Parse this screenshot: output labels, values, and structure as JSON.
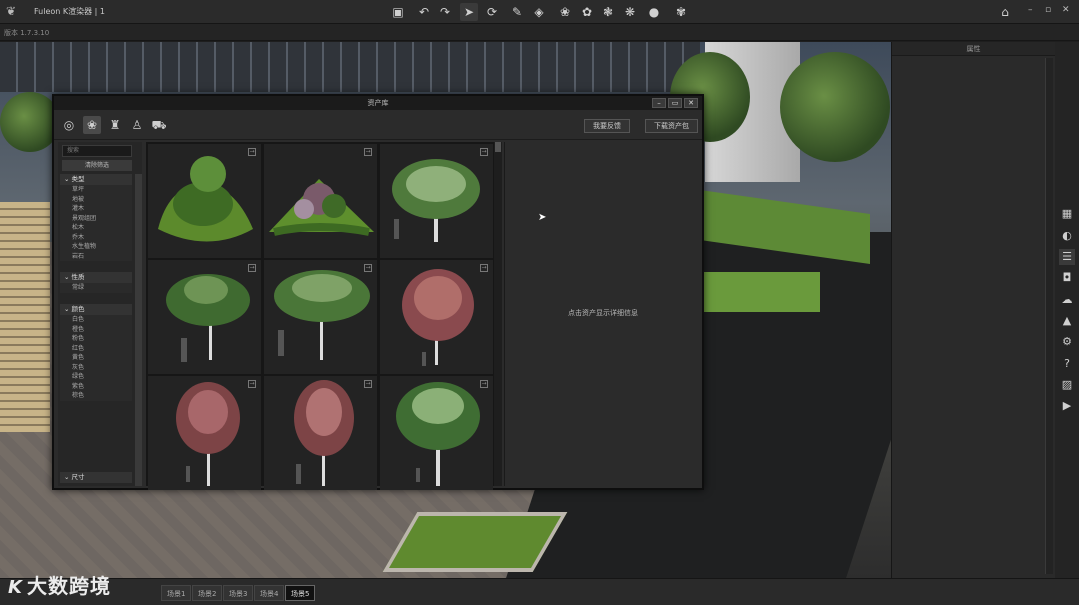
{
  "app": {
    "title": "Fuleon K渲染器 | 1",
    "version": "版本 1.7.3.10"
  },
  "toolbar": {
    "icons": [
      "save-icon",
      "undo-icon",
      "redo-icon",
      "select-icon",
      "rotate-icon",
      "pen-icon",
      "paint-bucket-icon",
      "tree-brush-icon",
      "tree-scatter-icon",
      "grass-icon",
      "plant-icon",
      "shrub-icon",
      "leaf-icon",
      "home-icon"
    ]
  },
  "props_panel": {
    "title": "属性"
  },
  "dialog": {
    "title": "资产库",
    "feedback_button": "我要反馈",
    "download_button": "下载资产包",
    "search_placeholder": "搜索",
    "clear_filter": "清除筛选",
    "preview_hint": "点击资产显示详细信息",
    "filter_groups": [
      {
        "label": "类型",
        "items": [
          "草坪",
          "地被",
          "灌木",
          "景观组团",
          "松木",
          "乔木",
          "水生植物",
          "岩石"
        ]
      },
      {
        "label": "性质",
        "items": [
          "常绿"
        ]
      },
      {
        "label": "颜色",
        "items": [
          "白色",
          "橙色",
          "粉色",
          "红色",
          "黄色",
          "灰色",
          "绿色",
          "紫色",
          "棕色"
        ]
      },
      {
        "label": "尺寸",
        "items": []
      }
    ],
    "assets": [
      {
        "kind": "planting-mound"
      },
      {
        "kind": "hedge-garden"
      },
      {
        "kind": "broadleaf-tree"
      },
      {
        "kind": "spreading-tree"
      },
      {
        "kind": "canopy-tree"
      },
      {
        "kind": "red-maple-tree"
      },
      {
        "kind": "red-leaf-tree"
      },
      {
        "kind": "red-leaf-tree"
      },
      {
        "kind": "round-tree"
      }
    ]
  },
  "scene_tabs": [
    "场景1",
    "场景2",
    "场景3",
    "场景4",
    "场景5"
  ],
  "active_scene_tab": "场景5",
  "watermark": "大数跨境",
  "side_tools": [
    "grid-icon",
    "globe-icon",
    "list-icon",
    "camera-icon",
    "weather-icon",
    "terrain-icon",
    "settings-icon",
    "help-icon",
    "image-icon",
    "video-icon"
  ]
}
